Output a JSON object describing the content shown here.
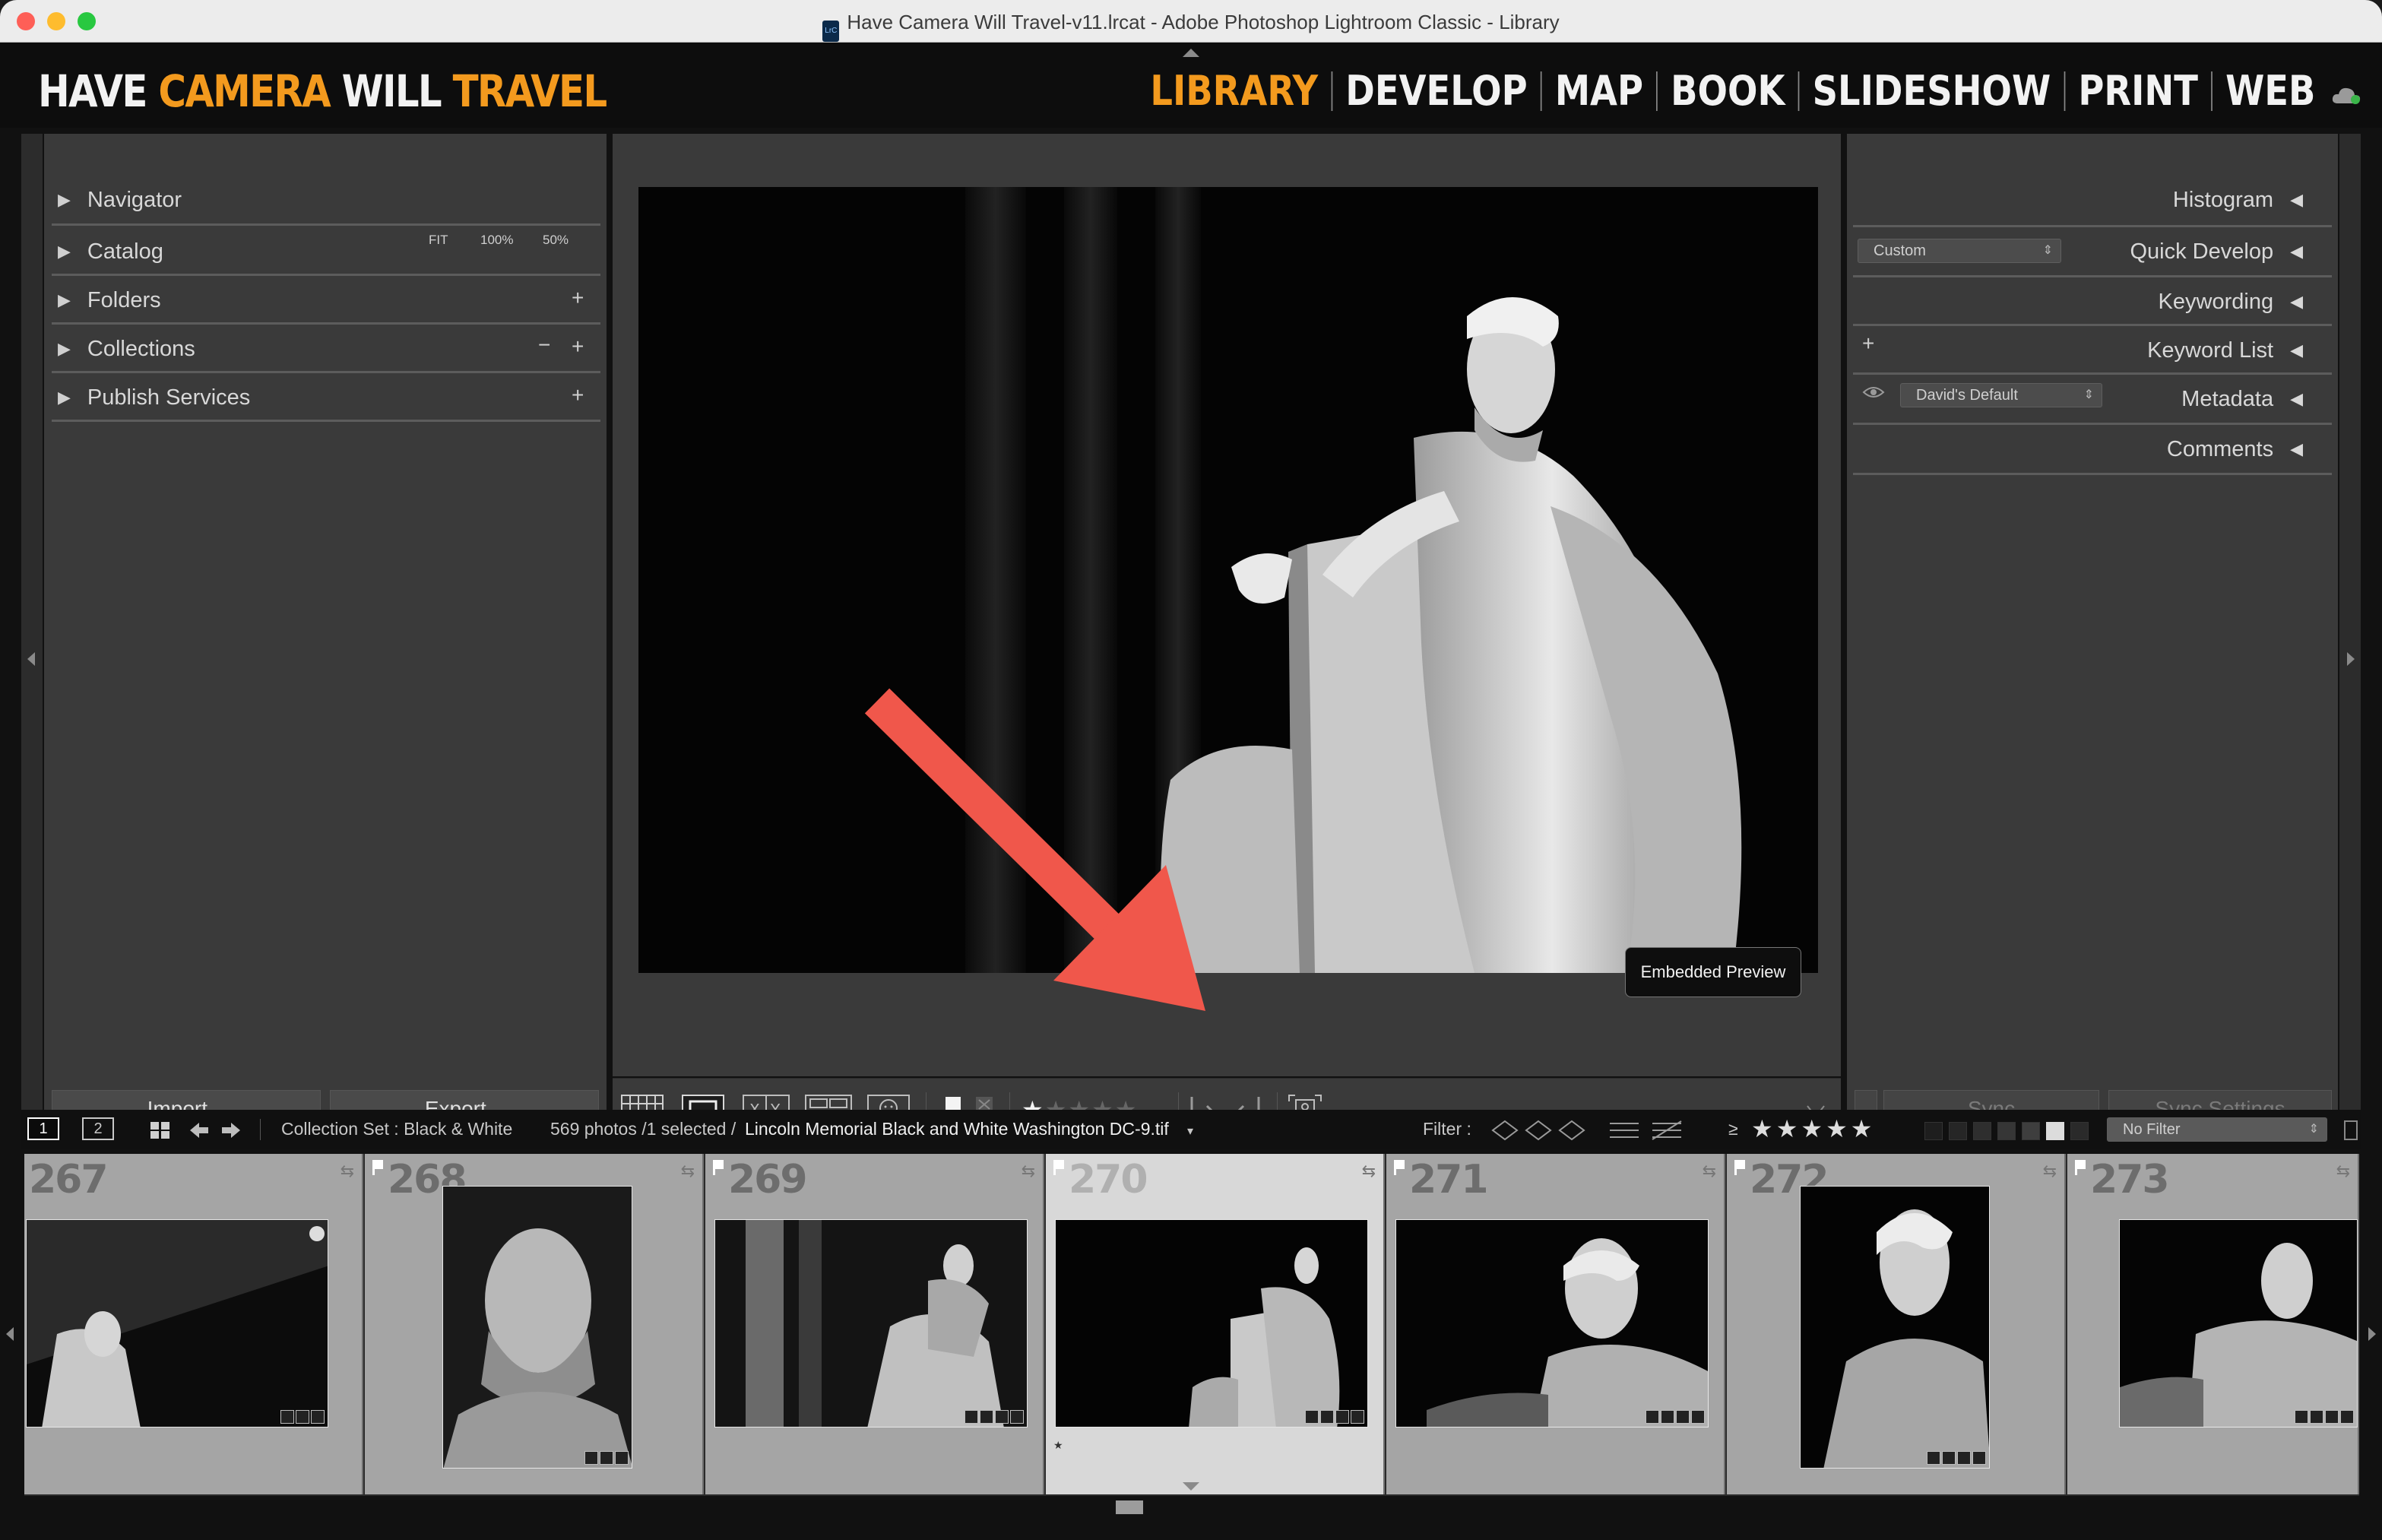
{
  "window": {
    "title": "Have Camera Will Travel-v11.lrcat - Adobe Photoshop Lightroom Classic - Library",
    "doc_icon": "LrC"
  },
  "identity_plate": {
    "word1": "HAVE",
    "word2": "CAMERA",
    "word3": "WILL",
    "word4": "TRAVEL",
    "accent_color": "#f39a1e"
  },
  "modules": [
    "LIBRARY",
    "DEVELOP",
    "MAP",
    "BOOK",
    "SLIDESHOW",
    "PRINT",
    "WEB"
  ],
  "active_module": "LIBRARY",
  "left_panel": {
    "panels": [
      "Navigator",
      "Catalog",
      "Folders",
      "Collections",
      "Publish Services"
    ],
    "navigator_zoom": {
      "fit": "FIT",
      "z100": "100%",
      "z50": "50%"
    },
    "import_label": "Import...",
    "export_label": "Export..."
  },
  "right_panel": {
    "panels": [
      "Histogram",
      "Quick Develop",
      "Keywording",
      "Keyword List",
      "Metadata",
      "Comments"
    ],
    "quick_develop_preset": "Custom",
    "metadata_preset": "David's Default",
    "sync_label": "Sync",
    "sync_settings_label": "Sync Settings"
  },
  "loupe": {
    "preview_badge": "Embedded Preview"
  },
  "toolbar": {
    "rating_icon": "star-rating-icon"
  },
  "filmstrip_bar": {
    "screen1": "1",
    "screen2": "2",
    "source": "Collection Set : Black & White",
    "count": "569 photos /1 selected /",
    "filename": "Lincoln Memorial Black and White Washington DC-9.tif",
    "filter_label": "Filter :",
    "rating_op": "≥",
    "stars": "★★★★★",
    "filter_preset": "No Filter"
  },
  "filmstrip": {
    "cells": [
      {
        "num": "267"
      },
      {
        "num": "268"
      },
      {
        "num": "269"
      },
      {
        "num": "270"
      },
      {
        "num": "271"
      },
      {
        "num": "272"
      },
      {
        "num": "273"
      }
    ],
    "selected_index": 3
  },
  "annotation": {
    "arrow_color": "#f0574b"
  }
}
